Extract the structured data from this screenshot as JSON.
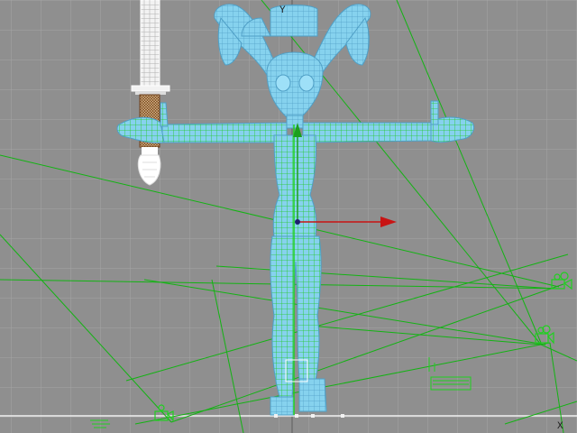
{
  "viewport": {
    "axis_y_label": "Y",
    "axis_x_label": "X",
    "grid_color": "#a6a6a6",
    "background_color": "#8f8f8f"
  },
  "colors": {
    "mesh": "#86d2ee",
    "mesh_dark": "#5aa8cc",
    "selection": "#1fd11f",
    "camera_lines": "#13b313",
    "gizmo_x": "#c81414",
    "gizmo_y": "#1ca01c",
    "sword_hilt": "#8b5a2b",
    "ground_axis": "#f2f2f2"
  },
  "objects": {
    "character": "character-wireframe-mesh",
    "sword": "sword-mesh",
    "transform_gizmo": "move-gizmo",
    "cameras": [
      "camera-icon",
      "camera-icon",
      "camera-icon",
      "camera-icon"
    ]
  }
}
